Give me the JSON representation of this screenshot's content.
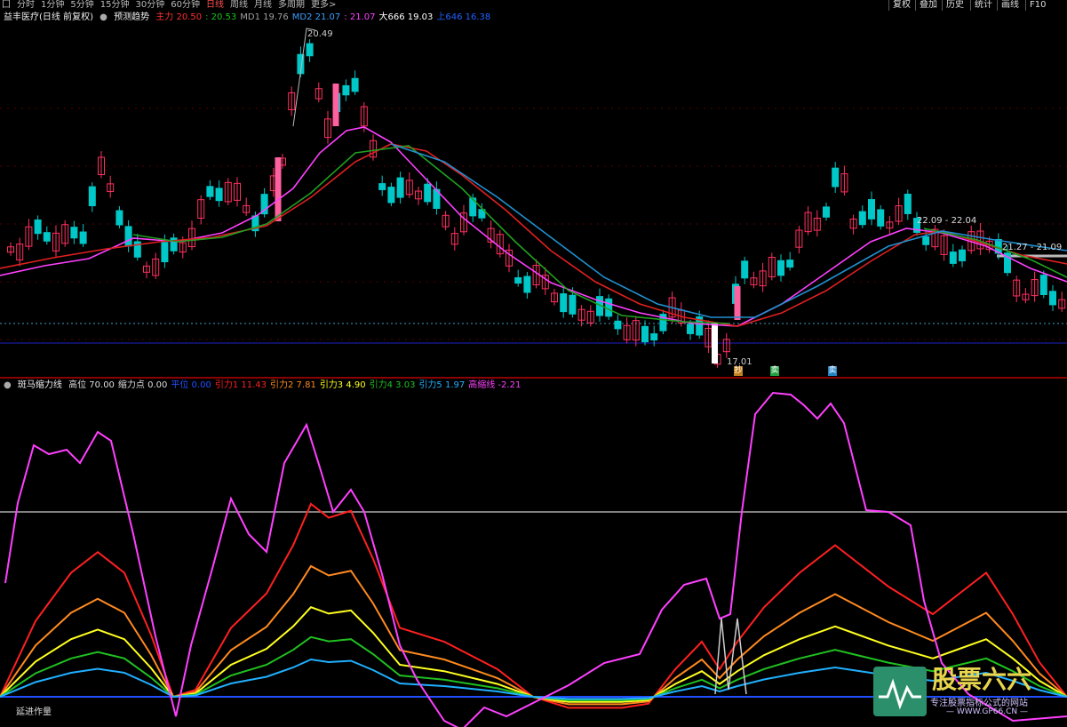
{
  "toolbar": {
    "tabs": [
      {
        "label": "囗",
        "active": false
      },
      {
        "label": "分时",
        "active": false
      },
      {
        "label": "1分钟",
        "active": false
      },
      {
        "label": "5分钟",
        "active": false
      },
      {
        "label": "15分钟",
        "active": false
      },
      {
        "label": "30分钟",
        "active": false
      },
      {
        "label": "60分钟",
        "active": false
      },
      {
        "label": "日线",
        "active": true
      },
      {
        "label": "周线",
        "active": false
      },
      {
        "label": "月线",
        "active": false
      },
      {
        "label": "多周期",
        "active": false
      },
      {
        "label": "更多>",
        "active": false
      }
    ],
    "buttons": [
      "复权",
      "叠加",
      "历史",
      "统计",
      "画线",
      "F10"
    ]
  },
  "main_legend": {
    "title": "益丰医疗(日线 前复权)",
    "predict": "预测趋势",
    "items": [
      {
        "label": "主力",
        "value": "20.50",
        "color": "#ff3030"
      },
      {
        "label": "",
        "value": "20.53",
        "color": "#19c219"
      },
      {
        "label": "MD1",
        "value": "19.76",
        "color": "#a0a0a0"
      },
      {
        "label": "MD2",
        "value": "21.07",
        "color": "#3aa0ff"
      },
      {
        "label": "",
        "value": "21.07",
        "color": "#ff40ff"
      },
      {
        "label": "大666",
        "value": "19.03",
        "color": "#ffffff"
      },
      {
        "label": "上646",
        "value": "16.38",
        "color": "#2060ff"
      }
    ]
  },
  "indicator_legend": {
    "title": "斑马缩力线",
    "items": [
      {
        "label": "高位",
        "value": "70.00",
        "color": "#dddddd"
      },
      {
        "label": "缩力点",
        "value": "0.00",
        "color": "#dddddd"
      },
      {
        "label": "平位",
        "value": "0.00",
        "color": "#2050ff"
      },
      {
        "label": "引力1",
        "value": "11.43",
        "color": "#ff2020"
      },
      {
        "label": "引力2",
        "value": "7.81",
        "color": "#ff8a20"
      },
      {
        "label": "引力3",
        "value": "4.90",
        "color": "#ffff20"
      },
      {
        "label": "引力4",
        "value": "3.03",
        "color": "#20c020"
      },
      {
        "label": "引力5",
        "value": "1.97",
        "color": "#20b0ff"
      },
      {
        "label": "高缩线",
        "value": "-2.21",
        "color": "#ff40ff"
      }
    ]
  },
  "annotations": {
    "high_price": "20.49",
    "low_price": "17.01",
    "resistance1": "22.09 - 22.04",
    "resistance2": "21.27 - 21.09",
    "markers": [
      "抄",
      "卖",
      "卖"
    ]
  },
  "footer": {
    "label": "延进作量"
  },
  "watermark": {
    "brand": "股票六六",
    "slogan": "专注股票指标公式的网站",
    "url": "— WWW.GP66.CN —"
  },
  "colors": {
    "up": "#ff3060",
    "down": "#00c8c8",
    "ma_short": "#ff40ff",
    "ma_mid": "#e02020",
    "ma_long": "#20a020",
    "ma_longer": "#2090d0"
  }
}
